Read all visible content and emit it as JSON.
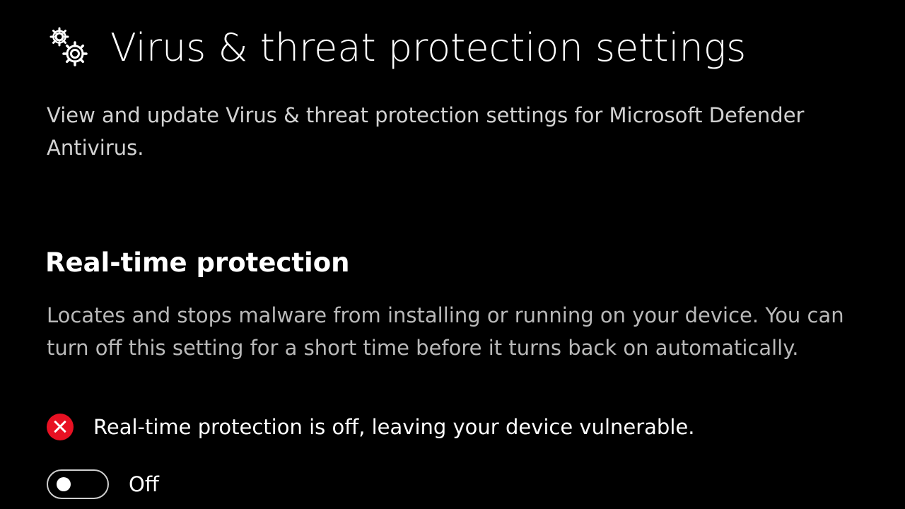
{
  "header": {
    "title": "Virus & threat protection settings",
    "icon": "gears-icon"
  },
  "page_description": "View and update Virus & threat protection settings for Microsoft Defender Antivirus.",
  "realtime": {
    "title": "Real-time protection",
    "description": "Locates and stops malware from installing or running on your device. You can turn off this setting for a short time before it turns back on automatically.",
    "status_icon": "error-circle-icon",
    "status_color": "#e81123",
    "status_text": "Real-time protection is off, leaving your device vulnerable.",
    "toggle": {
      "state": "off",
      "label": "Off"
    }
  },
  "colors": {
    "background": "#000000",
    "text_primary": "#ffffff",
    "text_secondary": "#b9b9b9"
  }
}
